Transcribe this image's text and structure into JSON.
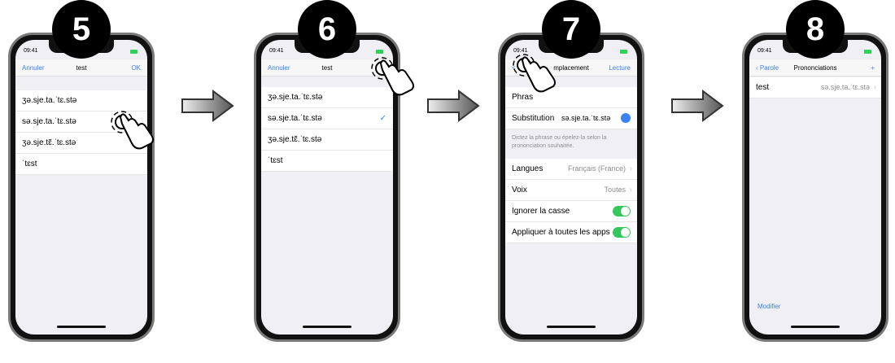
{
  "steps": [
    {
      "number": "5",
      "time": "09:41",
      "nav": {
        "left": "Annuler",
        "title": "test",
        "right": "OK"
      },
      "rows": [
        "ʒə.sje.ta.ˈtɛ.stə",
        "sə.sje.ta.ˈtɛ.stə",
        "ʒə.sje.tɛ̃.ˈtɛ.stə",
        "ˈtɛst"
      ]
    },
    {
      "number": "6",
      "time": "09:41",
      "nav": {
        "left": "Annuler",
        "title": "test",
        "right": ""
      },
      "rows": [
        "ʒə.sje.ta.ˈtɛ.stə",
        "sə.sje.ta.ˈtɛ.stə",
        "ʒə.sje.tɛ̃.ˈtɛ.stə",
        "ˈtɛst"
      ],
      "checkmark": "✓"
    },
    {
      "number": "7",
      "time": "09:41",
      "nav": {
        "left": "",
        "title": "mplacement",
        "right": "Lecture"
      },
      "phrase_label": "Phras",
      "substitution_label": "Substitution",
      "substitution_value": "sə.sje.ta.ˈtɛ.stə",
      "helper": "Dictez la phrase ou épelez-la selon la prononciation souhaitée.",
      "settings": [
        {
          "label": "Langues",
          "value": "Français (France)"
        },
        {
          "label": "Voix",
          "value": "Toutes"
        }
      ],
      "toggles": [
        {
          "label": "Ignorer la casse",
          "on": true
        },
        {
          "label": "Appliquer à toutes les apps",
          "on": true
        }
      ]
    },
    {
      "number": "8",
      "time": "09:41",
      "nav": {
        "left": "Parole",
        "title": "Prononciations",
        "right": "+"
      },
      "row": {
        "label": "test",
        "value": "sə.sje.ta.ˈtɛ.stə"
      },
      "footer": "Modifier"
    }
  ],
  "colors": {
    "accent": "#3b82f6",
    "toggle_on": "#34c759",
    "battery": "#30d158"
  }
}
